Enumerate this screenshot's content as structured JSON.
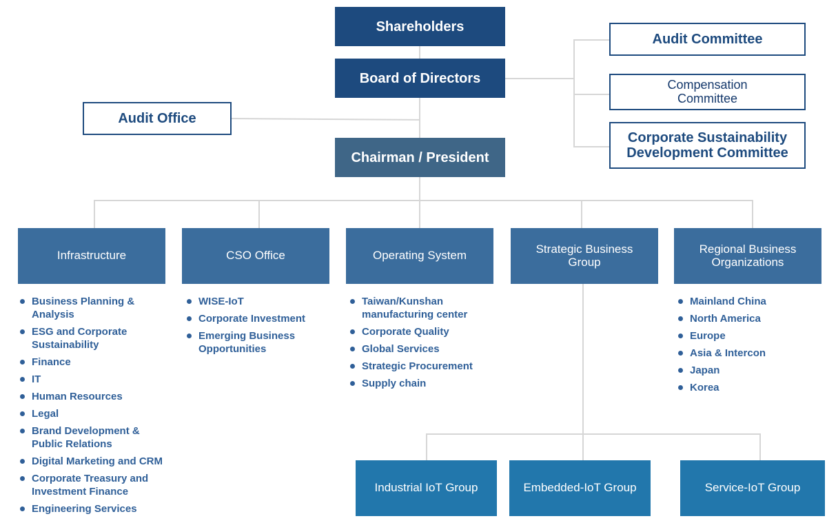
{
  "top": {
    "shareholders": "Shareholders",
    "board": "Board of Directors",
    "audit_office": "Audit Office",
    "chairman": "Chairman / President"
  },
  "committees": [
    "Audit Committee",
    "Compensation Committee",
    "Corporate Sustainability Development Committee"
  ],
  "divisions": [
    {
      "title": "Infrastructure",
      "items": [
        "Business Planning & Analysis",
        "ESG and Corporate Sustainability",
        "Finance",
        "IT",
        "Human Resources",
        "Legal",
        "Brand Development & Public Relations",
        "Digital Marketing and CRM",
        "Corporate Treasury and Investment Finance",
        "Engineering Services"
      ]
    },
    {
      "title": "CSO Office",
      "items": [
        "WISE-IoT",
        "Corporate Investment",
        "Emerging Business Opportunities"
      ]
    },
    {
      "title": "Operating System",
      "items": [
        "Taiwan/Kunshan manufacturing center",
        "Corporate Quality",
        "Global Services",
        "Strategic Procurement",
        "Supply chain"
      ]
    },
    {
      "title": "Strategic Business Group",
      "items": []
    },
    {
      "title": "Regional Business Organizations",
      "items": [
        "Mainland China",
        "North America",
        "Europe",
        "Asia & Intercon",
        "Japan",
        "Korea"
      ]
    }
  ],
  "groups": [
    "Industrial IoT Group",
    "Embedded-IoT Group",
    "Service-IoT Group"
  ],
  "colors": {
    "top_box": "#1d4a7e",
    "chairman_box": "#3f6687",
    "division_box": "#3b6d9d",
    "group_box": "#2277ac",
    "list_text": "#2f5f98",
    "connector": "#d6d6d6"
  }
}
